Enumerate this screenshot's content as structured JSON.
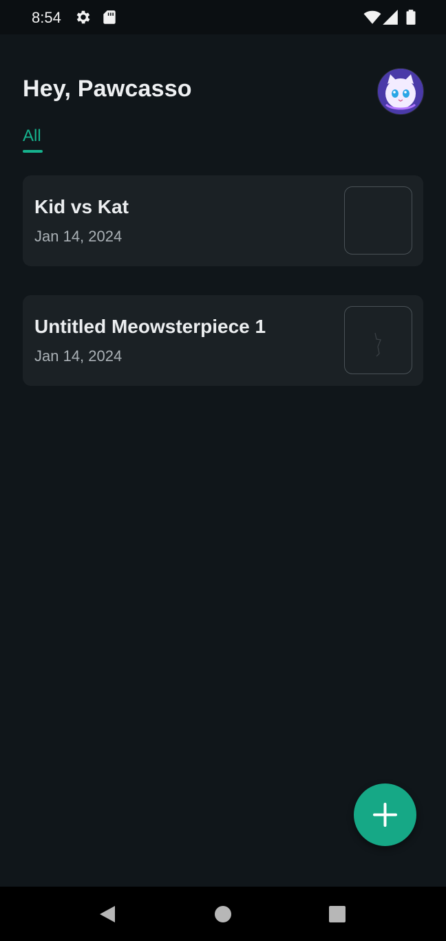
{
  "status_bar": {
    "time": "8:54",
    "icons": [
      "settings-icon",
      "sd-card-icon",
      "wifi-icon",
      "signal-icon",
      "battery-icon"
    ]
  },
  "header": {
    "greeting": "Hey, Pawcasso",
    "avatar_icon": "cat-avatar"
  },
  "tabs": [
    {
      "label": "All",
      "active": true
    }
  ],
  "colors": {
    "accent": "#16b38e",
    "background": "#10161a",
    "card": "#1b2125"
  },
  "drawings": [
    {
      "title": "Kid vs Kat",
      "date": "Jan 14, 2024",
      "thumbnail": "empty"
    },
    {
      "title": "Untitled Meowsterpiece 1",
      "date": "Jan 14, 2024",
      "thumbnail": "scribble"
    }
  ],
  "fab": {
    "icon": "plus-icon"
  },
  "nav_bar": {
    "icons": [
      "back-icon",
      "home-icon",
      "recents-icon"
    ]
  }
}
